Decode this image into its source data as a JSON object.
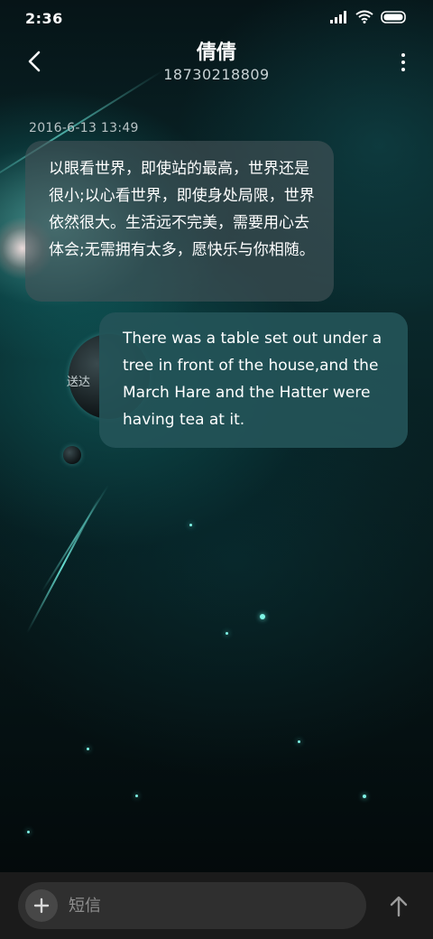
{
  "status_bar": {
    "time": "2:36",
    "icons": [
      "signal-icon",
      "wifi-icon",
      "battery-icon"
    ]
  },
  "header": {
    "back_icon": "chevron-left-icon",
    "contact_name": "倩倩",
    "contact_number": "18730218809",
    "more_icon": "more-vertical-icon"
  },
  "conversation": {
    "timestamp": "2016-6-13 13:49",
    "messages": [
      {
        "direction": "incoming",
        "text": "以眼看世界，即使站的最高，世界还是很小;以心看世界，即使身处局限，世界依然很大。生活远不完美，需要用心去体会;无需拥有太多，愿快乐与你相随。"
      },
      {
        "direction": "outgoing",
        "text": "There was a table set out under a tree in front of the house,and the March Hare and the Hatter were having tea at it.",
        "status": "送达"
      }
    ]
  },
  "composer": {
    "add_icon": "plus-icon",
    "placeholder": "短信",
    "value": "",
    "send_icon": "arrow-up-icon"
  },
  "colors": {
    "incoming_bubble": "#465458",
    "outgoing_bubble": "#245458",
    "bottom_bar": "#1b1b1b",
    "input_pill": "#2f2f2f"
  }
}
